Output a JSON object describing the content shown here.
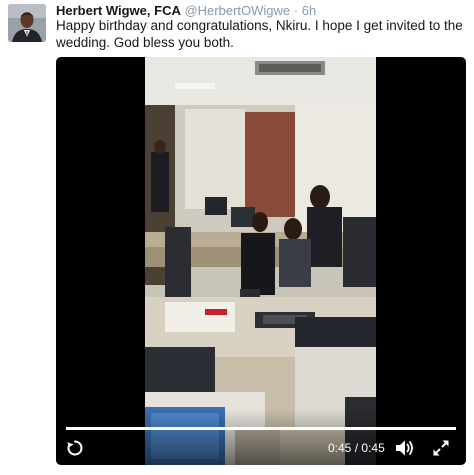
{
  "tweet": {
    "author_name": "Herbert Wigwe, FCA",
    "author_handle": "@HerbertOWigwe",
    "separator": "·",
    "timestamp": "6h",
    "text": "Happy birthday and congratulations, Nkiru. I hope I get invited to the wedding. God bless you both."
  },
  "video": {
    "current_time": "0:45",
    "time_separator": "/",
    "duration": "0:45",
    "progress_fraction": 1.0,
    "icons": {
      "replay": "replay-icon",
      "volume": "volume-icon",
      "fullscreen": "fullscreen-icon"
    }
  }
}
